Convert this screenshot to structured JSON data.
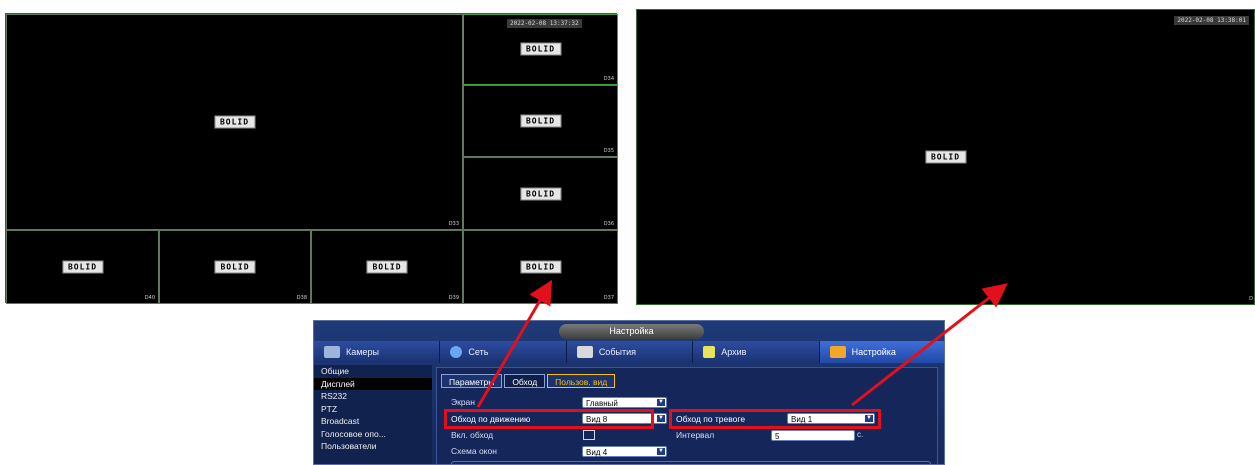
{
  "left_view": {
    "timestamp": "2022-02-08 13:37:32",
    "logo": "BOLID",
    "channels": [
      "D33",
      "D34",
      "D35",
      "D36",
      "D37",
      "D38",
      "D39",
      "D40"
    ]
  },
  "right_view": {
    "timestamp": "2022-02-08 13:38:01",
    "logo": "BOLID",
    "channel": "D"
  },
  "menu": {
    "title": "Настройка",
    "top_tabs": [
      {
        "label": "Камеры",
        "icon": "camera-icon"
      },
      {
        "label": "Сеть",
        "icon": "network-icon"
      },
      {
        "label": "События",
        "icon": "events-icon"
      },
      {
        "label": "Архив",
        "icon": "archive-icon"
      },
      {
        "label": "Настройка",
        "icon": "settings-icon"
      }
    ],
    "sidebar": [
      "Общие",
      "Дисплей",
      "RS232",
      "PTZ",
      "Broadcast",
      "Голосовое опо...",
      "Пользователи"
    ],
    "sub_tabs": [
      "Параметры",
      "Обход",
      "Пользов. вид"
    ],
    "fields": {
      "screen_label": "Экран",
      "screen_value": "Главный",
      "motion_tour_label": "Обход по движению",
      "motion_tour_value": "Вид 8",
      "alarm_tour_label": "Обход по тревоге",
      "alarm_tour_value": "Вид 1",
      "enable_tour_label": "Вкл. обход",
      "interval_label": "Интервал",
      "interval_value": "5",
      "interval_unit": "с.",
      "layout_label": "Схема окон",
      "layout_value": "Вид 4"
    }
  },
  "colors": {
    "highlight_red": "#e3101b",
    "menu_blue": "#1e3a78",
    "active_tab_yellow": "#f3c10e"
  }
}
